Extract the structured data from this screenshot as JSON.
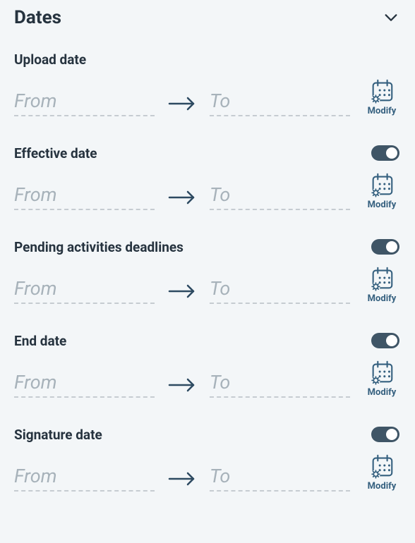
{
  "panel": {
    "title": "Dates"
  },
  "sections": {
    "upload": {
      "label": "Upload date",
      "from_ph": "From",
      "to_ph": "To",
      "modify_label": "Modify",
      "toggled": false
    },
    "effective": {
      "label": "Effective date",
      "from_ph": "From",
      "to_ph": "To",
      "modify_label": "Modify",
      "toggled": true
    },
    "pending": {
      "label": "Pending activities deadlines",
      "from_ph": "From",
      "to_ph": "To",
      "modify_label": "Modify",
      "toggled": true
    },
    "end": {
      "label": "End date",
      "from_ph": "From",
      "to_ph": "To",
      "modify_label": "Modify",
      "toggled": true
    },
    "signature": {
      "label": "Signature date",
      "from_ph": "From",
      "to_ph": "To",
      "modify_label": "Modify",
      "toggled": true
    }
  }
}
